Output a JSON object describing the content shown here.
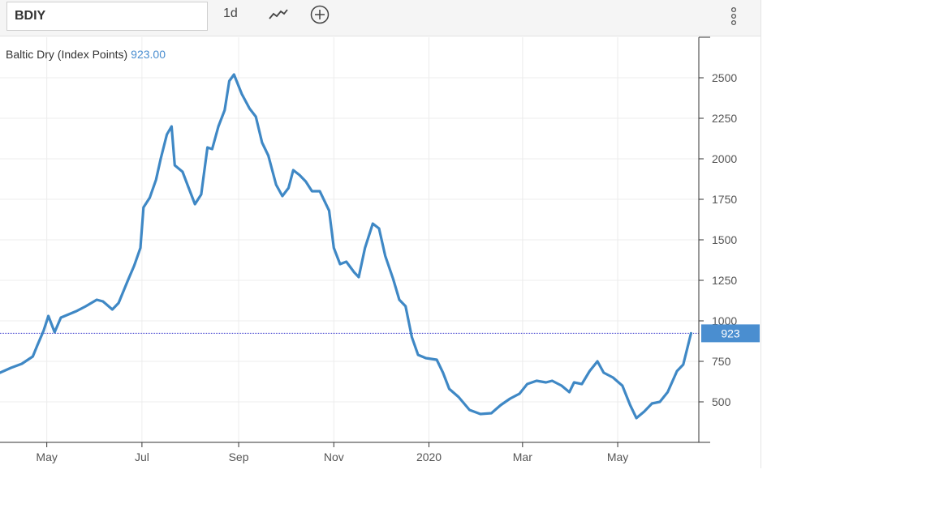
{
  "toolbar": {
    "symbol": "BDIY",
    "period_label": "1d",
    "chart_type_icon": "line-chart-icon",
    "add_icon": "plus-circle-icon",
    "more_icon": "more-vertical-icon"
  },
  "legend": {
    "series_name": "Baltic Dry (Index Points)",
    "last_value": "923.00"
  },
  "price_marker": {
    "label": "923",
    "color": "#4a8ed0"
  },
  "colors": {
    "line": "#3f88c5",
    "marker": "#4a8ed0",
    "reference_line": "#3333cc",
    "grid": "#ececec"
  },
  "chart_data": {
    "type": "line",
    "title": "",
    "series": [
      {
        "name": "Baltic Dry (Index Points)",
        "color": "#3f88c5",
        "points": [
          [
            "2019-04-01",
            680
          ],
          [
            "2019-04-08",
            710
          ],
          [
            "2019-04-15",
            735
          ],
          [
            "2019-04-22",
            780
          ],
          [
            "2019-04-25",
            850
          ],
          [
            "2019-04-29",
            940
          ],
          [
            "2019-05-02",
            1030
          ],
          [
            "2019-05-06",
            930
          ],
          [
            "2019-05-10",
            1020
          ],
          [
            "2019-05-15",
            1040
          ],
          [
            "2019-05-20",
            1060
          ],
          [
            "2019-05-26",
            1090
          ],
          [
            "2019-06-02",
            1130
          ],
          [
            "2019-06-06",
            1120
          ],
          [
            "2019-06-12",
            1070
          ],
          [
            "2019-06-16",
            1110
          ],
          [
            "2019-06-22",
            1250
          ],
          [
            "2019-06-26",
            1340
          ],
          [
            "2019-06-30",
            1450
          ],
          [
            "2019-07-02",
            1700
          ],
          [
            "2019-07-06",
            1760
          ],
          [
            "2019-07-10",
            1870
          ],
          [
            "2019-07-13",
            2000
          ],
          [
            "2019-07-17",
            2150
          ],
          [
            "2019-07-20",
            2200
          ],
          [
            "2019-07-22",
            1960
          ],
          [
            "2019-07-27",
            1920
          ],
          [
            "2019-07-31",
            1820
          ],
          [
            "2019-08-04",
            1720
          ],
          [
            "2019-08-08",
            1780
          ],
          [
            "2019-08-12",
            2070
          ],
          [
            "2019-08-15",
            2060
          ],
          [
            "2019-08-19",
            2200
          ],
          [
            "2019-08-23",
            2300
          ],
          [
            "2019-08-26",
            2480
          ],
          [
            "2019-08-29",
            2520
          ],
          [
            "2019-09-03",
            2400
          ],
          [
            "2019-09-08",
            2310
          ],
          [
            "2019-09-12",
            2260
          ],
          [
            "2019-09-16",
            2100
          ],
          [
            "2019-09-20",
            2020
          ],
          [
            "2019-09-25",
            1840
          ],
          [
            "2019-09-29",
            1770
          ],
          [
            "2019-10-03",
            1820
          ],
          [
            "2019-10-06",
            1930
          ],
          [
            "2019-10-10",
            1900
          ],
          [
            "2019-10-14",
            1860
          ],
          [
            "2019-10-18",
            1800
          ],
          [
            "2019-10-23",
            1800
          ],
          [
            "2019-10-29",
            1680
          ],
          [
            "2019-11-01",
            1450
          ],
          [
            "2019-11-05",
            1350
          ],
          [
            "2019-11-09",
            1365
          ],
          [
            "2019-11-14",
            1300
          ],
          [
            "2019-11-17",
            1270
          ],
          [
            "2019-11-21",
            1450
          ],
          [
            "2019-11-26",
            1600
          ],
          [
            "2019-11-30",
            1570
          ],
          [
            "2019-12-04",
            1400
          ],
          [
            "2019-12-09",
            1260
          ],
          [
            "2019-12-13",
            1130
          ],
          [
            "2019-12-17",
            1090
          ],
          [
            "2019-12-21",
            900
          ],
          [
            "2019-12-25",
            790
          ],
          [
            "2019-12-30",
            770
          ],
          [
            "2020-01-06",
            760
          ],
          [
            "2020-01-10",
            680
          ],
          [
            "2020-01-14",
            580
          ],
          [
            "2020-01-20",
            530
          ],
          [
            "2020-01-27",
            450
          ],
          [
            "2020-02-03",
            425
          ],
          [
            "2020-02-10",
            430
          ],
          [
            "2020-02-16",
            480
          ],
          [
            "2020-02-22",
            520
          ],
          [
            "2020-02-28",
            550
          ],
          [
            "2020-03-04",
            610
          ],
          [
            "2020-03-10",
            630
          ],
          [
            "2020-03-16",
            620
          ],
          [
            "2020-03-20",
            630
          ],
          [
            "2020-03-26",
            600
          ],
          [
            "2020-03-31",
            560
          ],
          [
            "2020-04-03",
            620
          ],
          [
            "2020-04-08",
            610
          ],
          [
            "2020-04-13",
            690
          ],
          [
            "2020-04-18",
            750
          ],
          [
            "2020-04-22",
            680
          ],
          [
            "2020-04-28",
            650
          ],
          [
            "2020-05-04",
            600
          ],
          [
            "2020-05-09",
            480
          ],
          [
            "2020-05-13",
            400
          ],
          [
            "2020-05-18",
            440
          ],
          [
            "2020-05-23",
            490
          ],
          [
            "2020-05-28",
            500
          ],
          [
            "2020-06-02",
            560
          ],
          [
            "2020-06-08",
            690
          ],
          [
            "2020-06-12",
            730
          ],
          [
            "2020-06-17",
            923
          ]
        ]
      }
    ],
    "x_ticks": [
      {
        "date": "2019-05-01",
        "label": "May"
      },
      {
        "date": "2019-07-01",
        "label": "Jul"
      },
      {
        "date": "2019-09-01",
        "label": "Sep"
      },
      {
        "date": "2019-11-01",
        "label": "Nov"
      },
      {
        "date": "2020-01-01",
        "label": "2020"
      },
      {
        "date": "2020-03-01",
        "label": "Mar"
      },
      {
        "date": "2020-05-01",
        "label": "May"
      }
    ],
    "y_ticks": [
      500,
      750,
      1000,
      1250,
      1500,
      1750,
      2000,
      2250,
      2500
    ],
    "xlim": [
      "2019-04-01",
      "2020-06-22"
    ],
    "ylim": [
      250,
      2750
    ],
    "reference_line": 923,
    "grid": true,
    "y_axis_side": "right"
  }
}
